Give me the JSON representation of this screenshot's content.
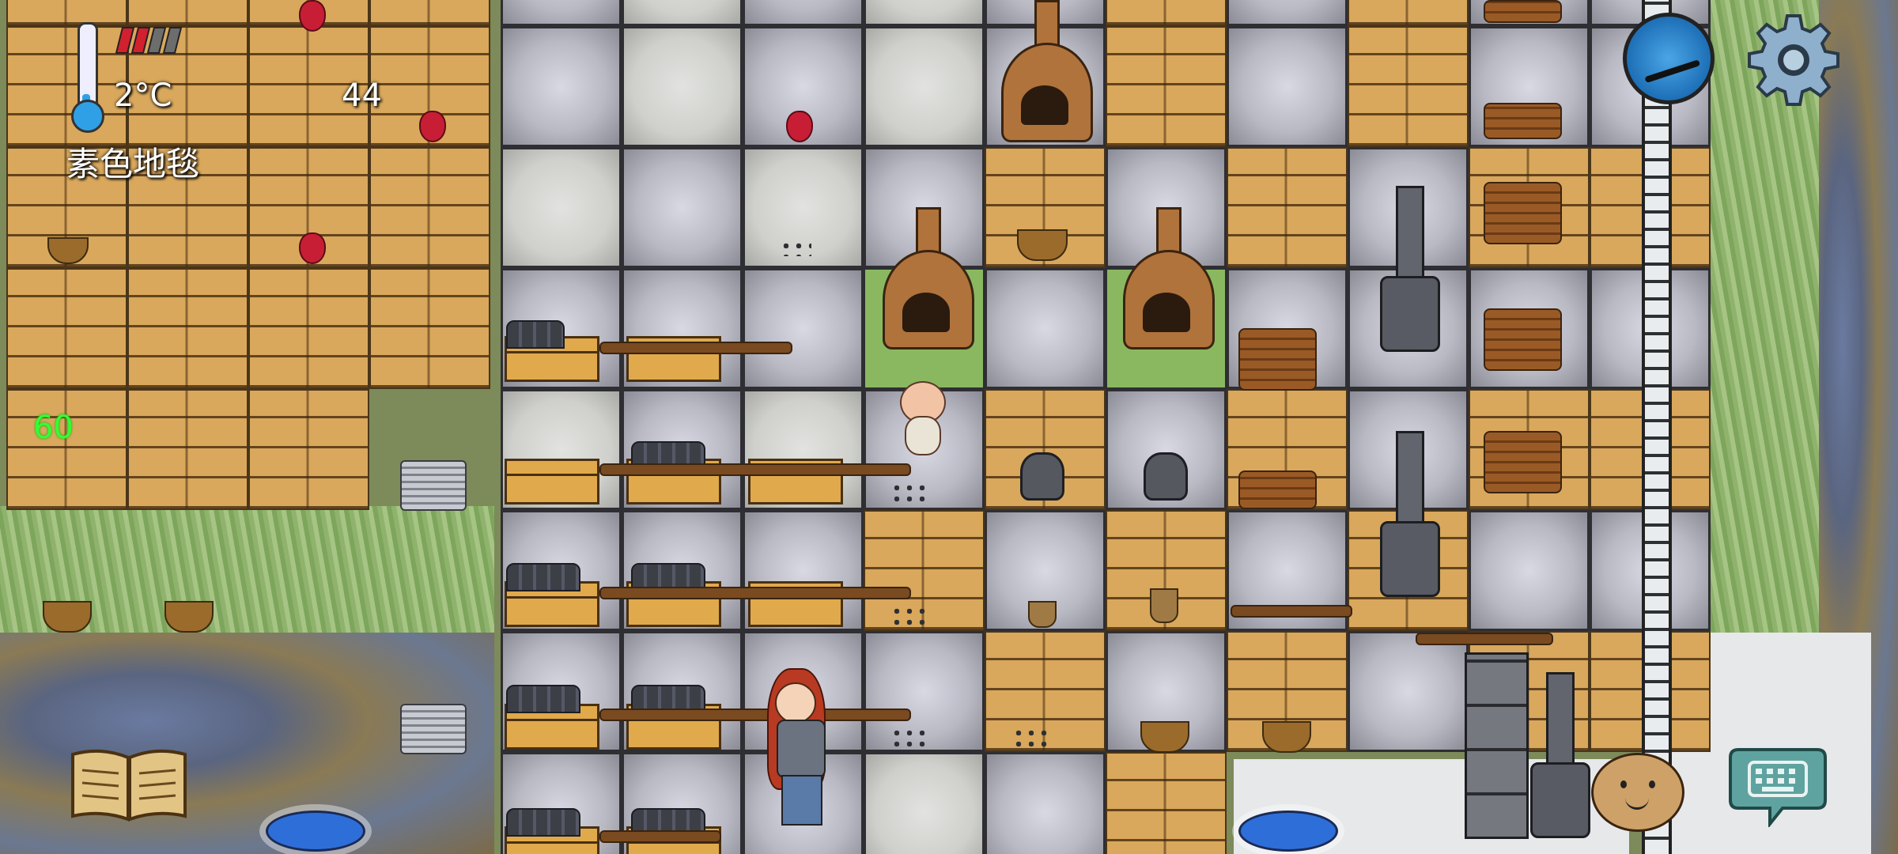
{
  "hud": {
    "temperature": "2°C",
    "age": "44",
    "item_name": "素色地毯",
    "lifespan": "60",
    "food_pips_filled": 2,
    "food_pips_total": 4,
    "thermometer_level": 0.15
  },
  "controls": {
    "compass_icon": "compass-icon",
    "settings_icon": "gear-icon",
    "recipe_book_icon": "open-book-icon",
    "emote_icon": "smiley-potato-icon",
    "keyboard_icon": "keyboard-chat-icon"
  },
  "colors": {
    "temperature_blue": "#2fa0e6",
    "food_red": "#d2202f",
    "lifespan_green": "#33ff33"
  }
}
